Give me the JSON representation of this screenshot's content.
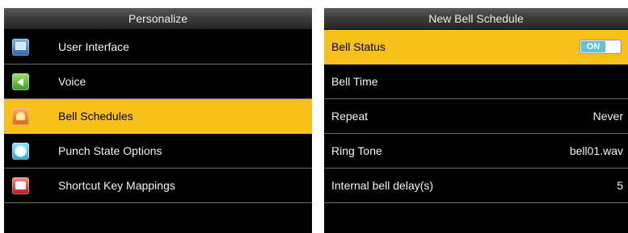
{
  "left_panel": {
    "title": "Personalize",
    "items": [
      {
        "label": "User Interface",
        "icon": "monitor-icon"
      },
      {
        "label": "Voice",
        "icon": "speaker-icon"
      },
      {
        "label": "Bell Schedules",
        "icon": "bell-icon",
        "selected": true
      },
      {
        "label": "Punch State Options",
        "icon": "gear-icon"
      },
      {
        "label": "Shortcut Key Mappings",
        "icon": "keyboard-icon"
      }
    ]
  },
  "right_panel": {
    "title": "New Bell Schedule",
    "bell_status": {
      "label": "Bell Status",
      "toggle": "ON"
    },
    "bell_time": {
      "label": "Bell Time",
      "value": ""
    },
    "repeat": {
      "label": "Repeat",
      "value": "Never"
    },
    "ring_tone": {
      "label": "Ring Tone",
      "value": "bell01.wav"
    },
    "bell_delay": {
      "label": "Internal bell delay(s)",
      "value": "5"
    }
  },
  "colors": {
    "highlight": "#f8c01b",
    "background": "#000000",
    "toggle_on": "#5fc3dc"
  }
}
